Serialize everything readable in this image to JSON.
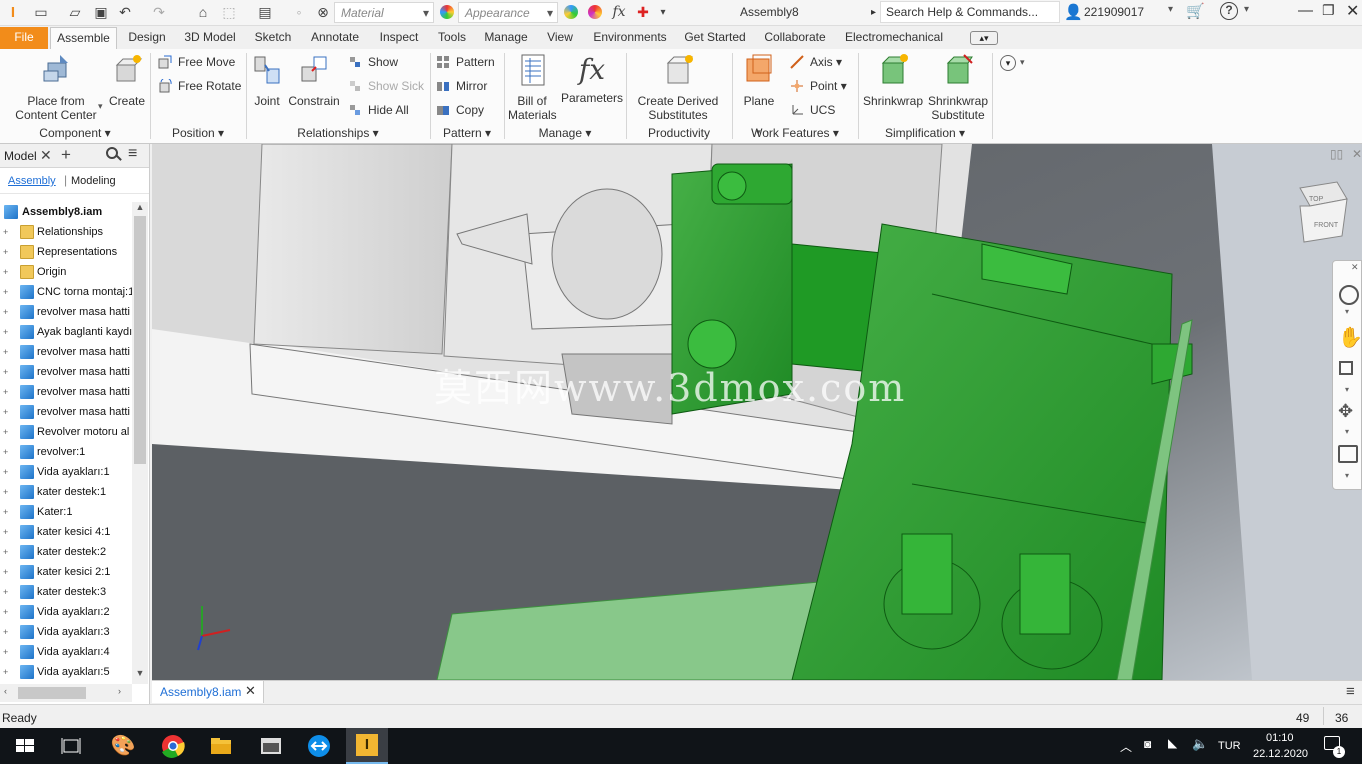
{
  "qat": {
    "material": "Material",
    "appearance": "Appearance",
    "title": "Assembly8",
    "search": "Search Help & Commands...",
    "user": "221909017"
  },
  "tabs": [
    "File",
    "Assemble",
    "Design",
    "3D Model",
    "Sketch",
    "Annotate",
    "Inspect",
    "Tools",
    "Manage",
    "View",
    "Environments",
    "Get Started",
    "Collaborate",
    "Electromechanical"
  ],
  "ribbon": {
    "place_l1": "Place from",
    "place_l2": "Content Center",
    "create": "Create",
    "free_move": "Free Move",
    "free_rotate": "Free Rotate",
    "joint": "Joint",
    "constrain": "Constrain",
    "show": "Show",
    "show_sick": "Show Sick",
    "hide_all": "Hide All",
    "pattern": "Pattern",
    "mirror": "Mirror",
    "copy": "Copy",
    "bom_l1": "Bill of",
    "bom_l2": "Materials",
    "parameters": "Parameters",
    "cds_l1": "Create Derived",
    "cds_l2": "Substitutes",
    "plane": "Plane",
    "axis": "Axis",
    "point": "Point",
    "ucs": "UCS",
    "shrinkwrap": "Shrinkwrap",
    "sws_l1": "Shrinkwrap",
    "sws_l2": "Substitute",
    "panels": {
      "component": "Component",
      "position": "Position",
      "relationships": "Relationships",
      "pattern": "Pattern",
      "manage": "Manage",
      "productivity": "Productivity",
      "work_features": "Work Features",
      "simplification": "Simplification"
    }
  },
  "browser": {
    "title": "Model",
    "tab_assembly": "Assembly",
    "tab_modeling": "Modeling",
    "root": "Assembly8.iam",
    "items": [
      "Relationships",
      "Representations",
      "Origin",
      "CNC torna montaj:1",
      "revolver masa hatti",
      "Ayak baglanti kaydı",
      "revolver masa hatti",
      "revolver masa hatti",
      "revolver masa hatti",
      "revolver masa hatti",
      "Revolver motoru al",
      "revolver:1",
      "Vida ayakları:1",
      "kater destek:1",
      "Kater:1",
      "kater kesici 4:1",
      "kater destek:2",
      "kater kesici 2:1",
      "kater destek:3",
      "Vida ayakları:2",
      "Vida ayakları:3",
      "Vida ayakları:4",
      "Vida ayakları:5"
    ]
  },
  "viewcube": {
    "top": "TOP",
    "front": "FRONT"
  },
  "watermark": "莫西网www.3dmox.com",
  "doc_tab": "Assembly8.iam",
  "status": {
    "text": "Ready",
    "n1": "49",
    "n2": "36"
  },
  "taskbar": {
    "lang": "TUR",
    "time": "01:10",
    "date": "22.12.2020",
    "notif": "1"
  }
}
